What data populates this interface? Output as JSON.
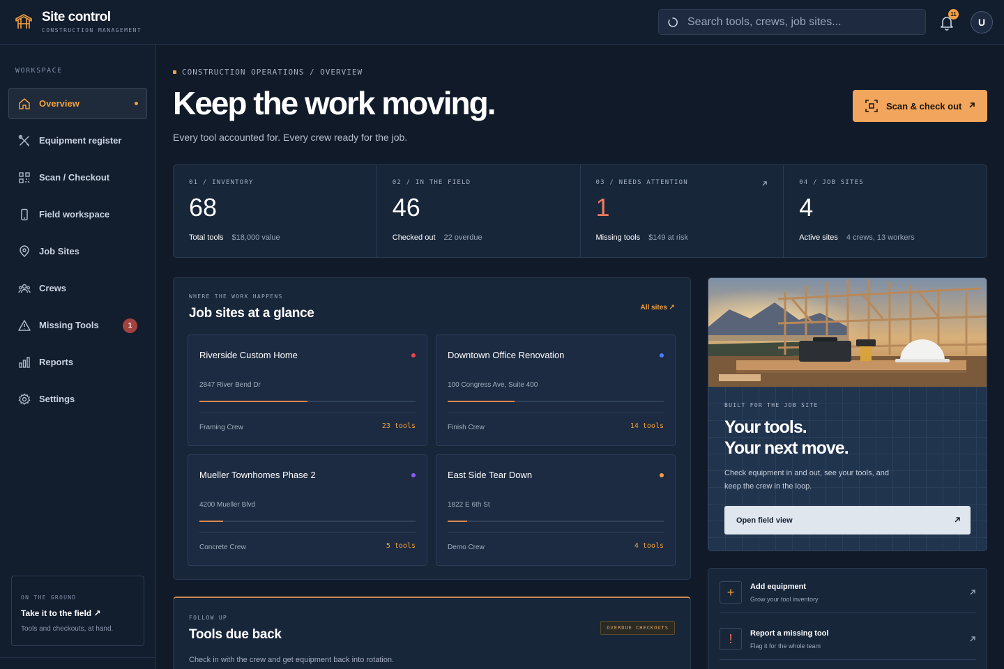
{
  "brand": {
    "title": "Site control",
    "subtitle": "CONSTRUCTION MANAGEMENT"
  },
  "search": {
    "placeholder": "Search tools, crews, job sites..."
  },
  "notifications": {
    "count": "11"
  },
  "user": {
    "initial": "U"
  },
  "sidebar": {
    "section": "WORKSPACE",
    "items": [
      {
        "label": "Overview",
        "icon": "home-icon",
        "active": true
      },
      {
        "label": "Equipment register",
        "icon": "tools-icon"
      },
      {
        "label": "Scan / Checkout",
        "icon": "qr-icon"
      },
      {
        "label": "Field workspace",
        "icon": "phone-icon"
      },
      {
        "label": "Job Sites",
        "icon": "map-pin-icon"
      },
      {
        "label": "Crews",
        "icon": "users-icon"
      },
      {
        "label": "Missing Tools",
        "icon": "alert-triangle-icon",
        "badge": "1"
      },
      {
        "label": "Reports",
        "icon": "bar-chart-icon"
      },
      {
        "label": "Settings",
        "icon": "gear-icon"
      }
    ],
    "card": {
      "kicker": "ON THE GROUND",
      "title": "Take it to the field ↗",
      "desc": "Tools and checkouts, at hand."
    }
  },
  "header": {
    "breadcrumb": "CONSTRUCTION OPERATIONS / OVERVIEW",
    "title": "Keep the work moving.",
    "subtitle": "Every tool accounted for. Every crew ready for the job.",
    "cta": "Scan & check out"
  },
  "stats": [
    {
      "kicker": "01 / INVENTORY",
      "value": "68",
      "label": "Total tools",
      "meta": "$18,000 value"
    },
    {
      "kicker": "02 / IN THE FIELD",
      "value": "46",
      "label": "Checked out",
      "meta": "22 overdue"
    },
    {
      "kicker": "03 / NEEDS ATTENTION",
      "value": "1",
      "label": "Missing tools",
      "meta": "$149 at risk"
    },
    {
      "kicker": "04 / JOB SITES",
      "value": "4",
      "label": "Active sites",
      "meta": "4 crews, 13 workers"
    }
  ],
  "sites_panel": {
    "kicker": "WHERE THE WORK HAPPENS",
    "title": "Job sites at a glance",
    "link": "All sites ↗",
    "sites": [
      {
        "name": "Riverside Custom Home",
        "address": "2847 River Bend Dr",
        "crew": "Framing Crew",
        "tools": "23 tools",
        "progress": 0.5,
        "dot": "#e5484d"
      },
      {
        "name": "Downtown Office Renovation",
        "address": "100 Congress Ave, Suite 400",
        "crew": "Finish Crew",
        "tools": "14 tools",
        "progress": 0.31,
        "dot": "#4c7dfa"
      },
      {
        "name": "Mueller Townhomes Phase 2",
        "address": "4200 Mueller Blvd",
        "crew": "Concrete Crew",
        "tools": "5 tools",
        "progress": 0.11,
        "dot": "#8b5cf6"
      },
      {
        "name": "East Side Tear Down",
        "address": "1822 E 6th St",
        "crew": "Demo Crew",
        "tools": "4 tools",
        "progress": 0.09,
        "dot": "#f2a03d"
      }
    ]
  },
  "due_panel": {
    "kicker": "FOLLOW UP",
    "title": "Tools due back",
    "badge": "OVERDUE CHECKOUTS",
    "desc": "Check in with the crew and get equipment back into rotation."
  },
  "promo": {
    "kicker": "BUILT FOR THE JOB SITE",
    "title_1": "Your tools.",
    "title_2": "Your next move.",
    "desc": "Check equipment in and out, see your tools, and keep the crew in the loop.",
    "button": "Open field view"
  },
  "actions": [
    {
      "title": "Add equipment",
      "desc": "Grow your tool inventory",
      "icon": "plus-icon"
    },
    {
      "title": "Report a missing tool",
      "desc": "Flag it for the whole team",
      "icon": "exclamation-icon"
    }
  ],
  "colors": {
    "accent": "#f2a03d",
    "background": "#101a29",
    "panel": "#18263a",
    "danger": "#a3423e"
  }
}
